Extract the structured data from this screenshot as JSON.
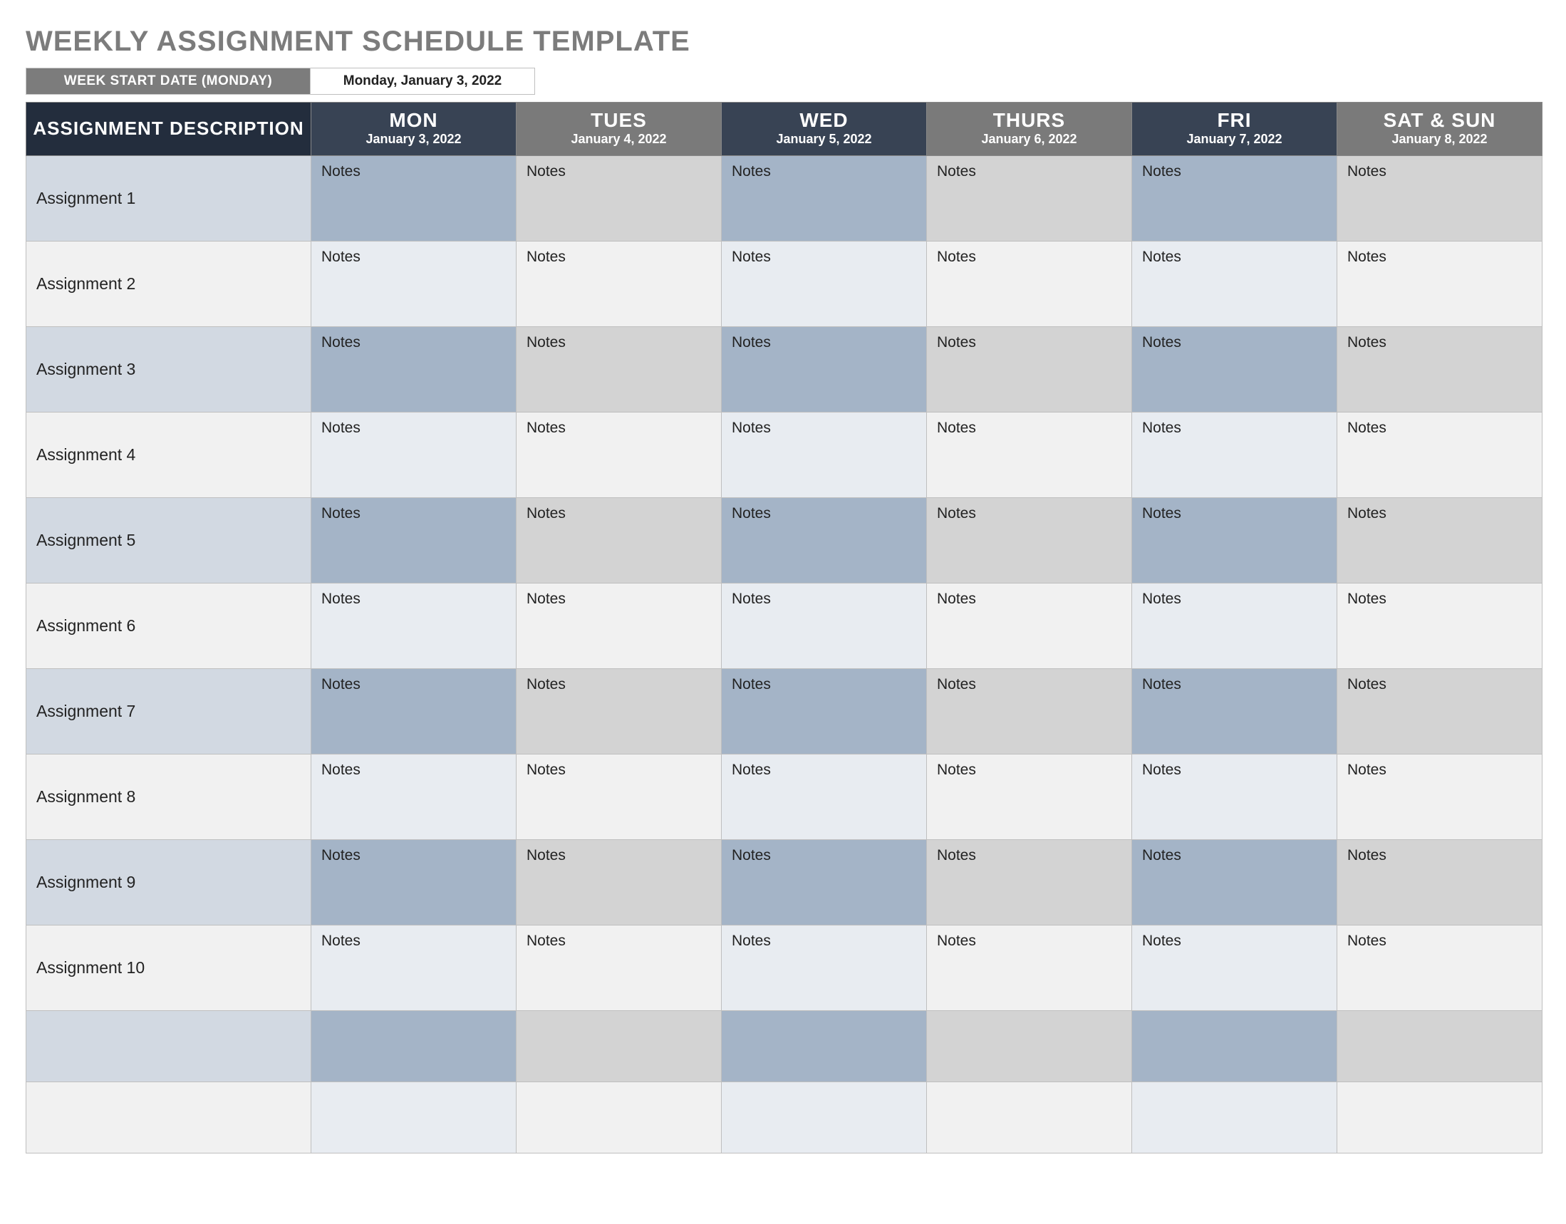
{
  "title": "WEEKLY ASSIGNMENT SCHEDULE TEMPLATE",
  "start_date": {
    "label": "WEEK START DATE (MONDAY)",
    "value": "Monday, January 3, 2022"
  },
  "columns": {
    "desc_header": "ASSIGNMENT DESCRIPTION",
    "days": [
      {
        "short": "MON",
        "date": "January 3, 2022",
        "tone": "dark"
      },
      {
        "short": "TUES",
        "date": "January 4, 2022",
        "tone": "light"
      },
      {
        "short": "WED",
        "date": "January 5, 2022",
        "tone": "dark"
      },
      {
        "short": "THURS",
        "date": "January 6, 2022",
        "tone": "light"
      },
      {
        "short": "FRI",
        "date": "January 7, 2022",
        "tone": "dark"
      },
      {
        "short": "SAT & SUN",
        "date": "January 8, 2022",
        "tone": "light"
      }
    ]
  },
  "note_label": "Notes",
  "rows": [
    {
      "desc": "Assignment 1",
      "has_notes": true,
      "shade": true
    },
    {
      "desc": "Assignment 2",
      "has_notes": true,
      "shade": false
    },
    {
      "desc": "Assignment 3",
      "has_notes": true,
      "shade": true
    },
    {
      "desc": "Assignment 4",
      "has_notes": true,
      "shade": false
    },
    {
      "desc": "Assignment 5",
      "has_notes": true,
      "shade": true
    },
    {
      "desc": "Assignment 6",
      "has_notes": true,
      "shade": false
    },
    {
      "desc": "Assignment 7",
      "has_notes": true,
      "shade": true
    },
    {
      "desc": "Assignment 8",
      "has_notes": true,
      "shade": false
    },
    {
      "desc": "Assignment 9",
      "has_notes": true,
      "shade": true
    },
    {
      "desc": "Assignment 10",
      "has_notes": true,
      "shade": false
    },
    {
      "desc": "",
      "has_notes": false,
      "shade": true
    },
    {
      "desc": "",
      "has_notes": false,
      "shade": false
    }
  ]
}
